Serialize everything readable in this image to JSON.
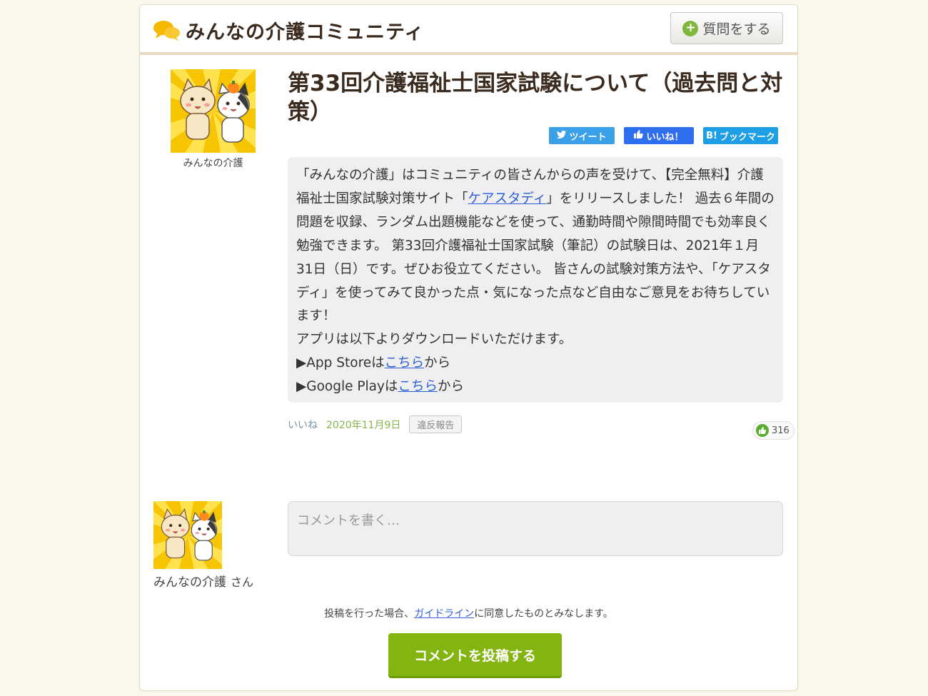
{
  "header": {
    "site_name": "みんなの介護コミュニティ",
    "ask_button_label": "質問をする"
  },
  "post": {
    "author_name": "みんなの介護",
    "title": "第33回介護福祉士国家試験について（過去問と対策）",
    "share": {
      "tweet_label": "ツイート",
      "like_label": "いいね！",
      "bookmark_label": "ブックマーク"
    },
    "body": {
      "p1_before_link": "「みんなの介護」はコミュニティの皆さんからの声を受けて、【完全無料】介護福祉士国家試験対策サイト「",
      "p1_link": "ケアスタディ",
      "p1_after_link": "」をリリースしました！ 過去６年間の問題を収録、ランダム出題機能などを使って、通勤時間や隙間時間でも効率良く勉強できます。 第33回介護福祉士国家試験（筆記）の試験日は、2021年１月31日（日）です。ぜひお役立てください。 皆さんの試験対策方法や、「ケアスタディ」を使ってみて良かった点・気になった点など自由なご意見をお待ちしています！",
      "p2": "アプリは以下よりダウンロードいただけます。",
      "app_store_prefix": "▶App Storeは",
      "app_store_link": "こちら",
      "app_store_suffix": "から",
      "google_play_prefix": "▶Google Playは",
      "google_play_link": "こちら",
      "google_play_suffix": "から"
    },
    "meta": {
      "like_link": "いいね",
      "date": "2020年11月9日",
      "report_button": "違反報告",
      "like_count": "316"
    }
  },
  "comment_form": {
    "commenter_name": "みんなの介護",
    "commenter_suffix": "さん",
    "placeholder": "コメントを書く…",
    "guideline_before": "投稿を行った場合、",
    "guideline_link": "ガイドライン",
    "guideline_after": "に同意したものとみなします。",
    "submit_label": "コメントを投稿する"
  },
  "colors": {
    "page_background": "#fbf7ea",
    "title_brown": "#3b2a1e",
    "submit_green": "#84b40f",
    "link_blue": "#2e5ed6",
    "twitter_blue": "#3aa0e8",
    "facebook_blue": "#2e6ff0",
    "hatena_blue": "#1e9ee6",
    "logo_yellow": "#f5b800"
  }
}
